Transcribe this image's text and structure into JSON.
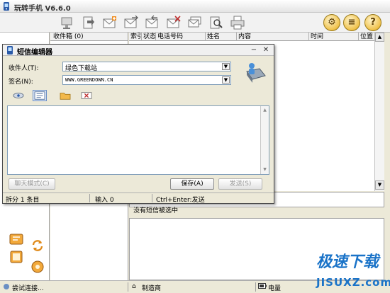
{
  "app": {
    "title": "玩转手机 V6.6.0"
  },
  "folder": {
    "inbox_label": "收件箱",
    "inbox_count": "(0)"
  },
  "grid": {
    "columns": [
      "索引",
      "状态",
      "电话号码",
      "姓名",
      "内容",
      "时间",
      "位置"
    ]
  },
  "preview": {
    "text": "没有短信被选中"
  },
  "status": {
    "connect": "尝试连接...",
    "maker": "制造商",
    "battery": "电量"
  },
  "dialog": {
    "title": "短信编辑器",
    "recipient_label": "收件人(T):",
    "recipient_value": "绿色下载站",
    "signature_label": "签名(N):",
    "signature_value": "WWW.GREENDOWN.CN",
    "chat_mode_button": "聊天模式(C)",
    "save_button": "保存(A)",
    "send_button": "发送(S)",
    "split_info": "拆分 1 条目",
    "input_info": "输入 0",
    "hint": "Ctrl+Enter:发送"
  },
  "watermark": {
    "line1": "极速下载",
    "line2": "JISUXZ.com"
  }
}
